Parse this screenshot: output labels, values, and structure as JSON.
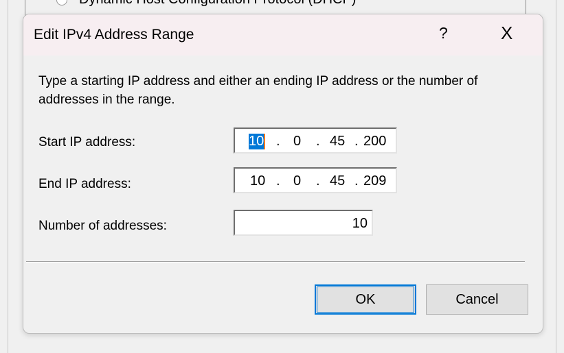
{
  "background": {
    "option_label": "Dynamic Host Configuration Protocol (DHCP)"
  },
  "dialog": {
    "title": "Edit IPv4 Address Range",
    "help_label": "?",
    "close_label": "X",
    "description": "Type a starting IP address and either an ending IP address or the number of addresses in the range.",
    "start": {
      "label": "Start IP address:",
      "octets": [
        "10",
        "0",
        "45",
        "200"
      ],
      "selected_octet": 0
    },
    "end": {
      "label": "End IP address:",
      "octets": [
        "10",
        "0",
        "45",
        "209"
      ]
    },
    "count": {
      "label": "Number of addresses:",
      "value": "10"
    },
    "ok_label": "OK",
    "cancel_label": "Cancel",
    "dot": "."
  }
}
